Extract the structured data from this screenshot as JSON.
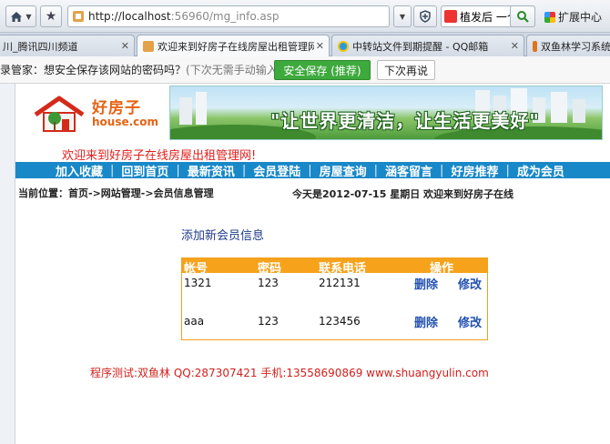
{
  "browser": {
    "url_host": "http://localhost",
    "url_rest": ":56960/mg_info.asp",
    "search_text": "植发后 一个",
    "ext_label": "扩展中心",
    "tabs": [
      {
        "label": "川_腾讯四川频道"
      },
      {
        "label": "欢迎来到好房子在线房屋出租管理网！"
      },
      {
        "label": "中转站文件到期提醒 - QQ邮箱"
      },
      {
        "label": "双鱼林学习系统"
      }
    ],
    "password_bar": {
      "message": "录管家：想安全保存该网站的密码吗？",
      "hint": "(下次无需手动输入)",
      "save_label": "安全保存 (推荐)",
      "later_label": "下次再说"
    }
  },
  "site": {
    "logo_cn": "好房子",
    "logo_en": "house.com",
    "banner_text": "\"让世界更清洁，让生活更美好\"",
    "welcome": "欢迎来到好房子在线房屋出租管理网!",
    "nav": [
      "加入收藏",
      "回到首页",
      "最新资讯",
      "会员登陆",
      "房屋查询",
      "涵客留言",
      "好房推荐",
      "成为会员"
    ],
    "breadcrumb": "当前位置：首页->网站管理->会员信息管理",
    "today": "今天是2012-07-15   星期日  欢迎来到好房子在线",
    "add_title": "添加新会员信息",
    "table": {
      "headers": [
        "帐号",
        "密码",
        "联系电话",
        "操作"
      ],
      "rows": [
        {
          "account": "1321",
          "password": "123",
          "phone": "212131",
          "delete": "删除",
          "edit": "修改"
        },
        {
          "account": "aaa",
          "password": "123",
          "phone": "123456",
          "delete": "删除",
          "edit": "修改"
        }
      ]
    },
    "footer": "程序测试:双鱼林 QQ:287307421 手机:13558690869 www.shuangyulin.com"
  }
}
